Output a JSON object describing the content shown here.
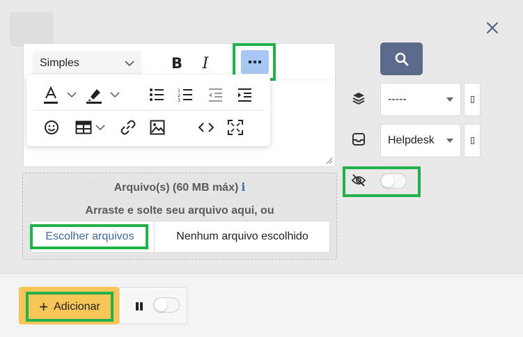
{
  "close_label": "×",
  "editor": {
    "format_select": "Simples",
    "bold_label": "B",
    "italic_label": "I",
    "more_label": "•••"
  },
  "dropzone": {
    "title": "Arquivo(s) (60 MB máx)",
    "info_label": "i",
    "subtitle": "Arraste e solte seu arquivo aqui, ou",
    "choose_label": "Escolher arquivos",
    "no_file_label": "Nenhum arquivo escolhido"
  },
  "side": {
    "dropdown1": "-----",
    "dropdown2": "Helpdesk",
    "visibility_toggle_on": false
  },
  "footer": {
    "add_icon": "+",
    "add_label": "Adicionar",
    "pause_toggle_on": false
  },
  "colors": {
    "accent_green": "#22b24c",
    "search_button": "#5c6b8c",
    "add_button": "#f7c659",
    "more_button": "#a9c7f3"
  }
}
